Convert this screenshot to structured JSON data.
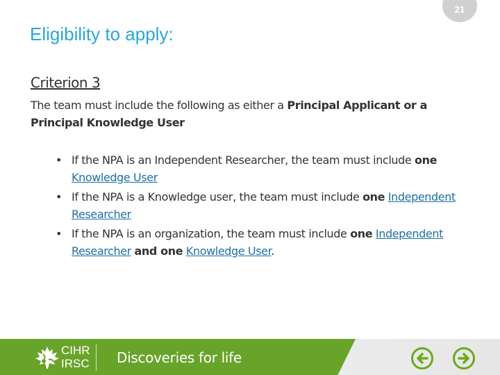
{
  "slide": {
    "page_number": "21",
    "title": "Eligibility to apply:",
    "criterion": "Criterion 3",
    "intro": {
      "text_1": "The team must include the following as either a ",
      "bold_1": "Principal Applicant or a Principal Knowledge User"
    },
    "bullets": [
      {
        "prefix": "If the NPA is an Independent Researcher, the team must include ",
        "bold": "one",
        "link": "Knowledge User",
        "suffix": ""
      },
      {
        "prefix": "If the NPA is a Knowledge user, the team must include ",
        "bold": "one",
        "link": "Independent Researcher",
        "suffix": ""
      },
      {
        "prefix": "If the NPA is an organization, the team must include ",
        "bold": "one",
        "link": "Independent Researcher",
        "bold2": "and one",
        "link2": "Knowledge User",
        "suffix": "."
      }
    ],
    "bullet_glyph": "•"
  },
  "footer": {
    "logo_line1": "CIHR",
    "logo_line2": "IRSC",
    "tagline": "Discoveries for life",
    "prev_icon": "arrow-left-circle-icon",
    "next_icon": "arrow-right-circle-icon"
  },
  "colors": {
    "title": "#2aa6d4",
    "link": "#1d6fa5",
    "footer_green": "#68a42a",
    "nav_icon": "#6aaa1c",
    "page_badge": "#d0d0d0"
  }
}
